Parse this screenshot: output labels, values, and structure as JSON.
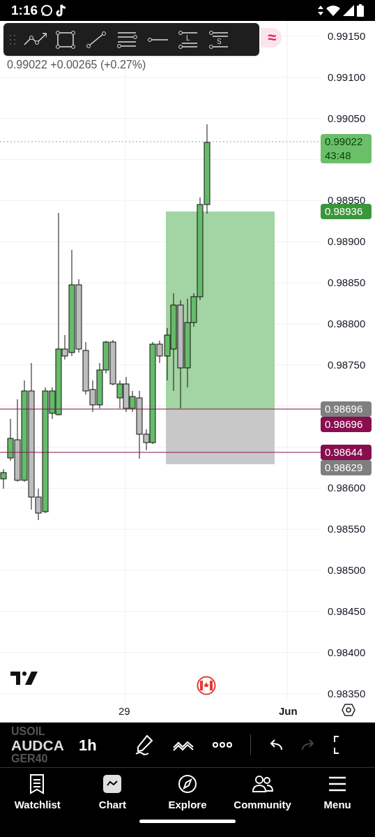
{
  "status_bar": {
    "time": "1:16"
  },
  "quote": {
    "price": "0.99022",
    "change": "+0.00265 (+0.27%)"
  },
  "drawing_toolbar": {
    "tools": [
      {
        "kind": "trend"
      },
      {
        "kind": "rectangle"
      },
      {
        "kind": "line"
      },
      {
        "kind": "channel"
      },
      {
        "kind": "ray"
      },
      {
        "kind": "long",
        "label": "L"
      },
      {
        "kind": "short",
        "label": "S"
      }
    ],
    "indicator": "≈"
  },
  "price_axis": {
    "labels": [
      "0.99150",
      "0.99100",
      "0.99050",
      "0.98950",
      "0.98900",
      "0.98850",
      "0.98800",
      "0.98750",
      "0.98600",
      "0.98550",
      "0.98500",
      "0.98450",
      "0.98400",
      "0.98350"
    ]
  },
  "price_badges": [
    {
      "kind": "last",
      "price": "0.99022",
      "countdown": "43:48",
      "color": "#6abf69"
    },
    {
      "kind": "target",
      "price": "0.98936",
      "color": "#3b963b"
    },
    {
      "kind": "entry",
      "price": "0.98696",
      "color": "#7f7f7f"
    },
    {
      "kind": "line",
      "price": "0.98696",
      "color": "#880e4f"
    },
    {
      "kind": "line",
      "price": "0.98644",
      "color": "#880e4f"
    },
    {
      "kind": "stop",
      "price": "0.98629",
      "color": "#7f7f7f"
    }
  ],
  "time_axis": {
    "labels": [
      {
        "text": "29",
        "kind": "day"
      },
      {
        "text": "Jun",
        "kind": "month"
      }
    ]
  },
  "chart_toolbar": {
    "symbols": [
      {
        "text": "USOIL",
        "selected": false
      },
      {
        "text": "AUDCA",
        "selected": true
      },
      {
        "text": "GER40",
        "selected": false
      }
    ],
    "interval": "1h",
    "redo_disabled": true
  },
  "nav": [
    {
      "label": "Watchlist",
      "selected": false
    },
    {
      "label": "Chart",
      "selected": true
    },
    {
      "label": "Explore",
      "selected": false
    },
    {
      "label": "Community",
      "selected": false
    },
    {
      "label": "Menu",
      "selected": false
    }
  ]
}
